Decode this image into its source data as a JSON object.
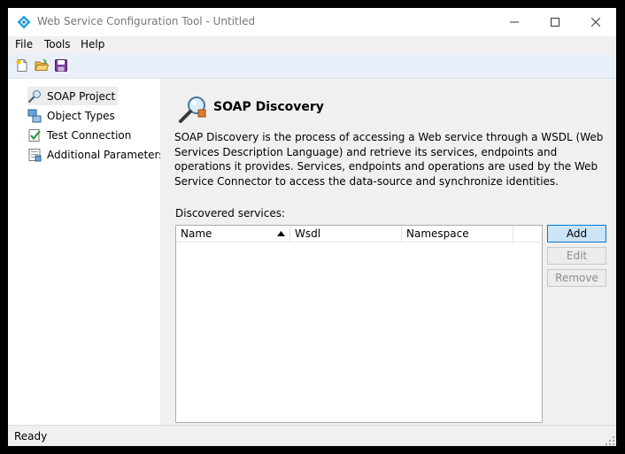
{
  "window": {
    "title": "Web Service Configuration Tool - Untitled"
  },
  "menu": {
    "items": [
      "File",
      "Tools",
      "Help"
    ]
  },
  "toolbar": {
    "buttons": [
      "new-icon",
      "open-folder-icon",
      "save-icon"
    ]
  },
  "nav": {
    "items": [
      {
        "label": "SOAP Project",
        "icon": "soap-project-icon",
        "selected": true
      },
      {
        "label": "Object Types",
        "icon": "object-types-icon",
        "selected": false
      },
      {
        "label": "Test Connection",
        "icon": "test-connection-icon",
        "selected": false
      },
      {
        "label": "Additional Parameters",
        "icon": "additional-parameters-icon",
        "selected": false
      }
    ]
  },
  "main": {
    "title": "SOAP Discovery",
    "description": "SOAP Discovery is the process of accessing a Web service through a WSDL (Web Services Description Language) and retrieve its services, endpoints and operations it provides. Services, endpoints and operations are used by the Web Service Connector to access the data-source and synchronize identities.",
    "services_label": "Discovered services:",
    "columns": [
      {
        "label": "Name",
        "sort": "ascending"
      },
      {
        "label": "Wsdl"
      },
      {
        "label": "Namespace"
      }
    ],
    "rows": [],
    "buttons": {
      "add": "Add",
      "edit": "Edit",
      "remove": "Remove"
    }
  },
  "status": {
    "text": "Ready"
  },
  "colors": {
    "accent": "#0078d7",
    "toolbar_bg": "#e9f0f9",
    "selected_bg": "#ececec"
  }
}
